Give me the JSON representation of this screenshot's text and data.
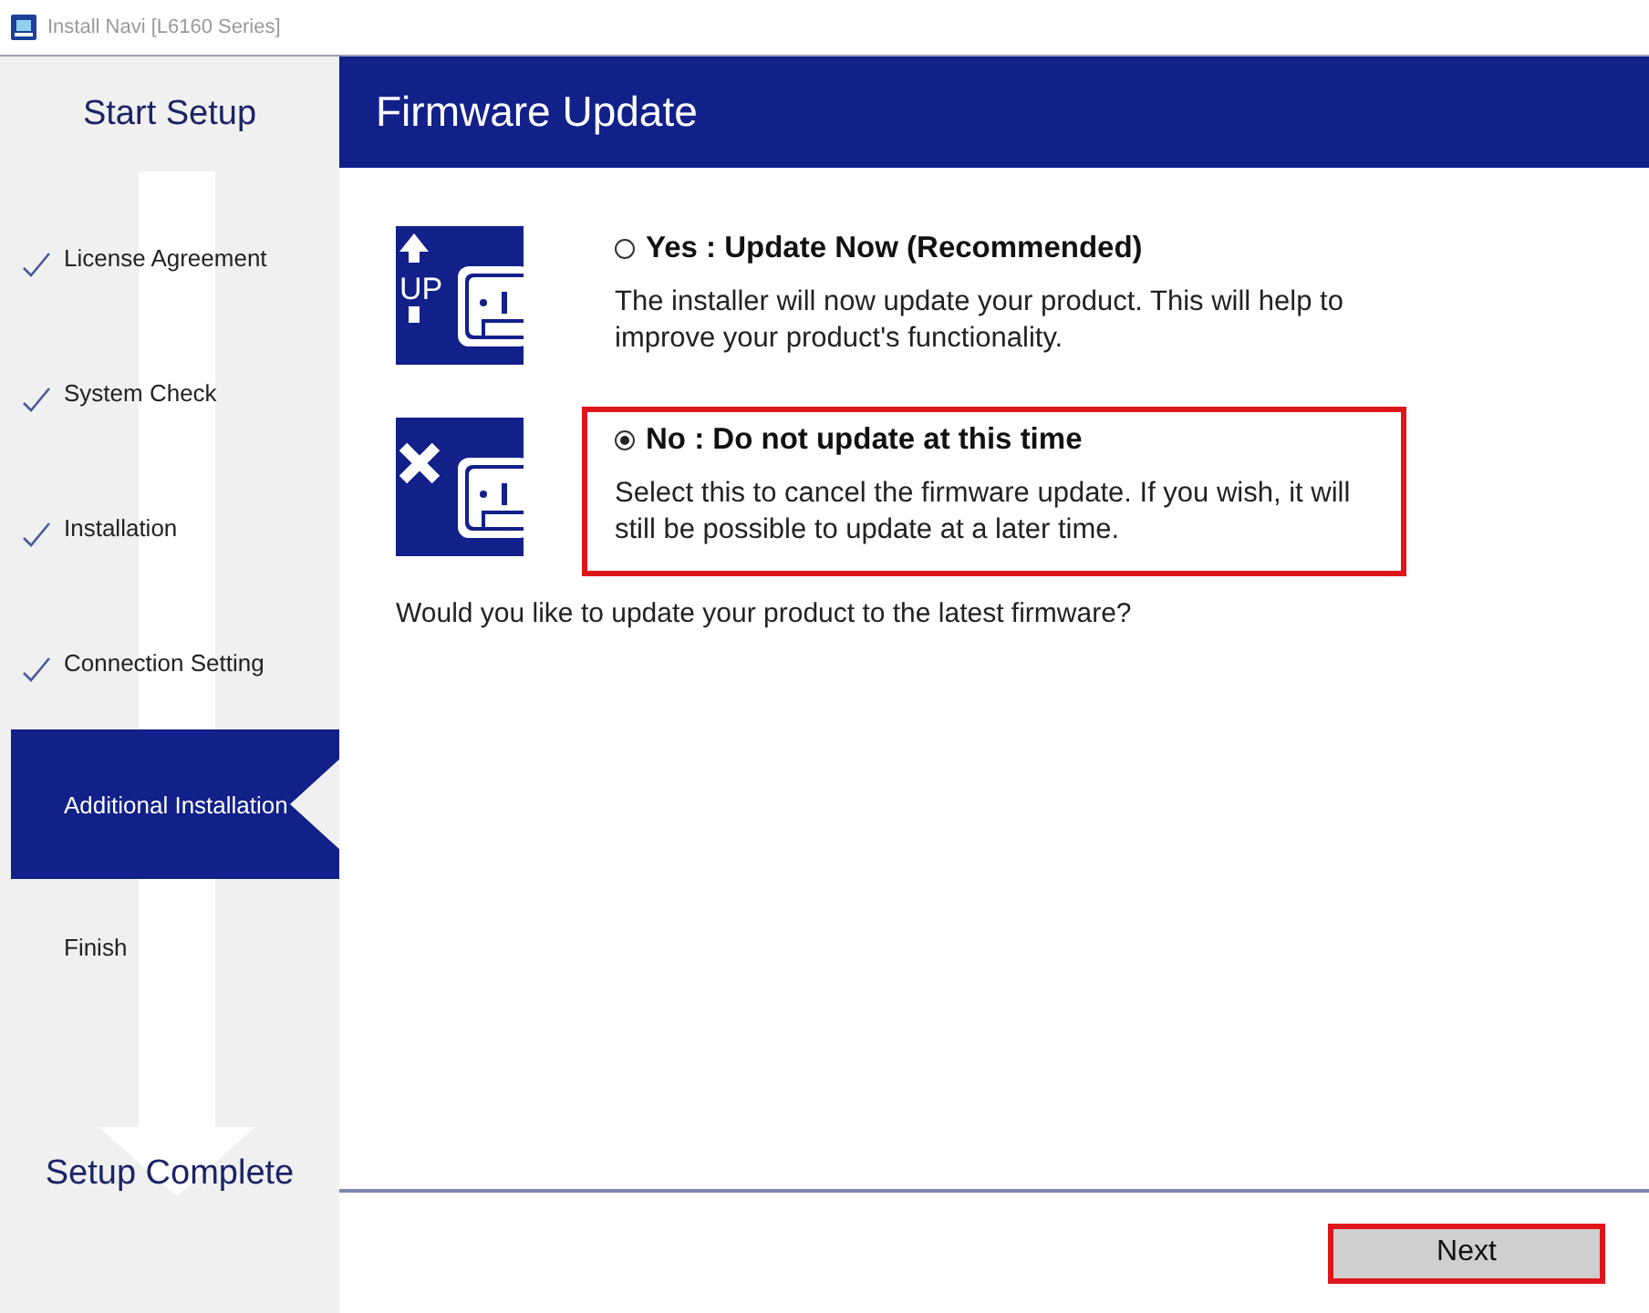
{
  "window": {
    "title": "Install Navi [L6160 Series]"
  },
  "sidebar": {
    "heading": "Start Setup",
    "footer": "Setup Complete",
    "steps": [
      {
        "label": "License Agreement",
        "completed": true,
        "selected": false
      },
      {
        "label": "System Check",
        "completed": true,
        "selected": false
      },
      {
        "label": "Installation",
        "completed": true,
        "selected": false
      },
      {
        "label": "Connection Setting",
        "completed": true,
        "selected": false
      },
      {
        "label": "Additional Installation",
        "completed": false,
        "selected": true
      },
      {
        "label": "Finish",
        "completed": false,
        "selected": false
      }
    ]
  },
  "page": {
    "title": "Firmware Update",
    "question": "Would you like to update your product to the latest firmware?"
  },
  "options": [
    {
      "kind": "update",
      "icon_label": "UP",
      "label": "Yes : Update Now (Recommended)",
      "description": "The installer will now update your product. This will help to improve your product's functionality.",
      "selected": false,
      "highlighted": false
    },
    {
      "kind": "skip",
      "label": "No : Do not update at this time",
      "description": "Select this to cancel the firmware update.  If you wish, it will still be possible to update at a later time.",
      "selected": true,
      "highlighted": true
    }
  ],
  "next_button": {
    "label": "Next",
    "highlighted": true
  }
}
